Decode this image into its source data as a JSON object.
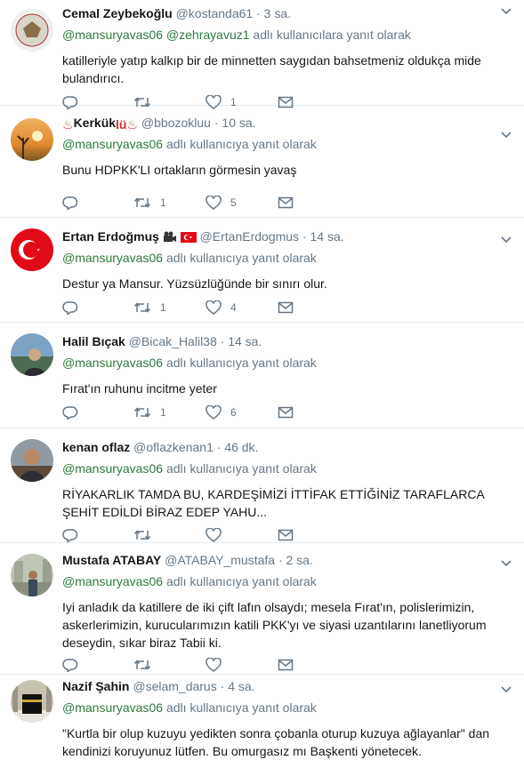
{
  "tweets": [
    {
      "name": "Cemal Zeybekoğlu",
      "handle": "@kostanda61",
      "time": "3 sa.",
      "reply_to": "@mansuryavas06 @zehrayavuz1",
      "reply_suffix": "adlı kullanıcılara yanıt olarak",
      "text": "katilleriyle yatıp kalkıp bir de minnetten saygıdan bahsetmeniz oldukça mide bulandırıcı.",
      "replies": "",
      "retweets": "",
      "likes": "1",
      "avatar": "emblem"
    },
    {
      "name": "Kerkük",
      "name_prefix": "♨",
      "name_suffix": "lü♨",
      "handle": "@bbozokluu",
      "time": "10 sa.",
      "reply_to": "@mansuryavas06",
      "reply_suffix": "adlı kullanıcıya yanıt olarak",
      "text": "Bunu HDPKK'LI ortakların görmesin yavaş",
      "replies": "",
      "retweets": "1",
      "likes": "5",
      "avatar": "sunset"
    },
    {
      "name": "Ertan Erdoğmuş",
      "handle": "@ErtanErdogmus",
      "time": "14 sa.",
      "reply_to": "@mansuryavas06",
      "reply_suffix": "adlı kullanıcıya yanıt olarak",
      "text": "Destur ya Mansur. Yüzsüzlüğünde bir sınırı olur.",
      "replies": "",
      "retweets": "1",
      "likes": "4",
      "avatar": "flag"
    },
    {
      "name": "Halil Bıçak",
      "handle": "@Bicak_Halil38",
      "time": "14 sa.",
      "reply_to": "@mansuryavas06",
      "reply_suffix": "adlı kullanıcıya yanıt olarak",
      "text": "Fırat'ın ruhunu incitme yeter",
      "replies": "",
      "retweets": "1",
      "likes": "6",
      "avatar": "photo"
    },
    {
      "name": "kenan oflaz",
      "handle": "@oflazkenan1",
      "time": "46 dk.",
      "reply_to": "@mansuryavas06",
      "reply_suffix": "adlı kullanıcıya yanıt olarak",
      "text": "RİYAKARLIK TAMDA BU, KARDEŞİMİZİ İTTİFAK ETTİĞİNİZ TARAFLARCA ŞEHİT EDİLDİ BİRAZ EDEP YAHU...",
      "replies": "",
      "retweets": "",
      "likes": "",
      "avatar": "person"
    },
    {
      "name": "Mustafa ATABAY",
      "handle": "@ATABAY_mustafa",
      "time": "2 sa.",
      "reply_to": "@mansuryavas06",
      "reply_suffix": "adlı kullanıcıya yanıt olarak",
      "text": "Iyi anladık da katillere de iki çift lafın olsaydı; mesela Fırat'ın, polislerimizin, askerlerimizin, kurucularımızın katili PKK'yı ve siyasi uzantılarını lanetliyorum deseydin, sıkar biraz Tabii ki.",
      "replies": "",
      "retweets": "",
      "likes": "",
      "avatar": "street"
    },
    {
      "name": "Nazif Şahin",
      "handle": "@selam_darus",
      "time": "4 sa.",
      "reply_to": "@mansuryavas06",
      "reply_suffix": "adlı kullanıcıya yanıt olarak",
      "text": "\"Kurtla bir olup kuzuyu yedikten sonra çobanla oturup kuzuya ağlayanlar\" dan kendinizi koruyunuz lütfen. Bu omurgasız mı Başkenti yönetecek.",
      "replies": "",
      "retweets": "",
      "likes": "",
      "avatar": "kaaba"
    }
  ],
  "colors": {
    "mention": "#2b7a3d",
    "muted": "#657786",
    "text": "#14171a",
    "divider": "#e6ecf0"
  },
  "icons": {
    "reply": "reply-icon",
    "retweet": "retweet-icon",
    "like": "heart-icon",
    "dm": "envelope-icon",
    "more": "chevron-down-icon"
  }
}
